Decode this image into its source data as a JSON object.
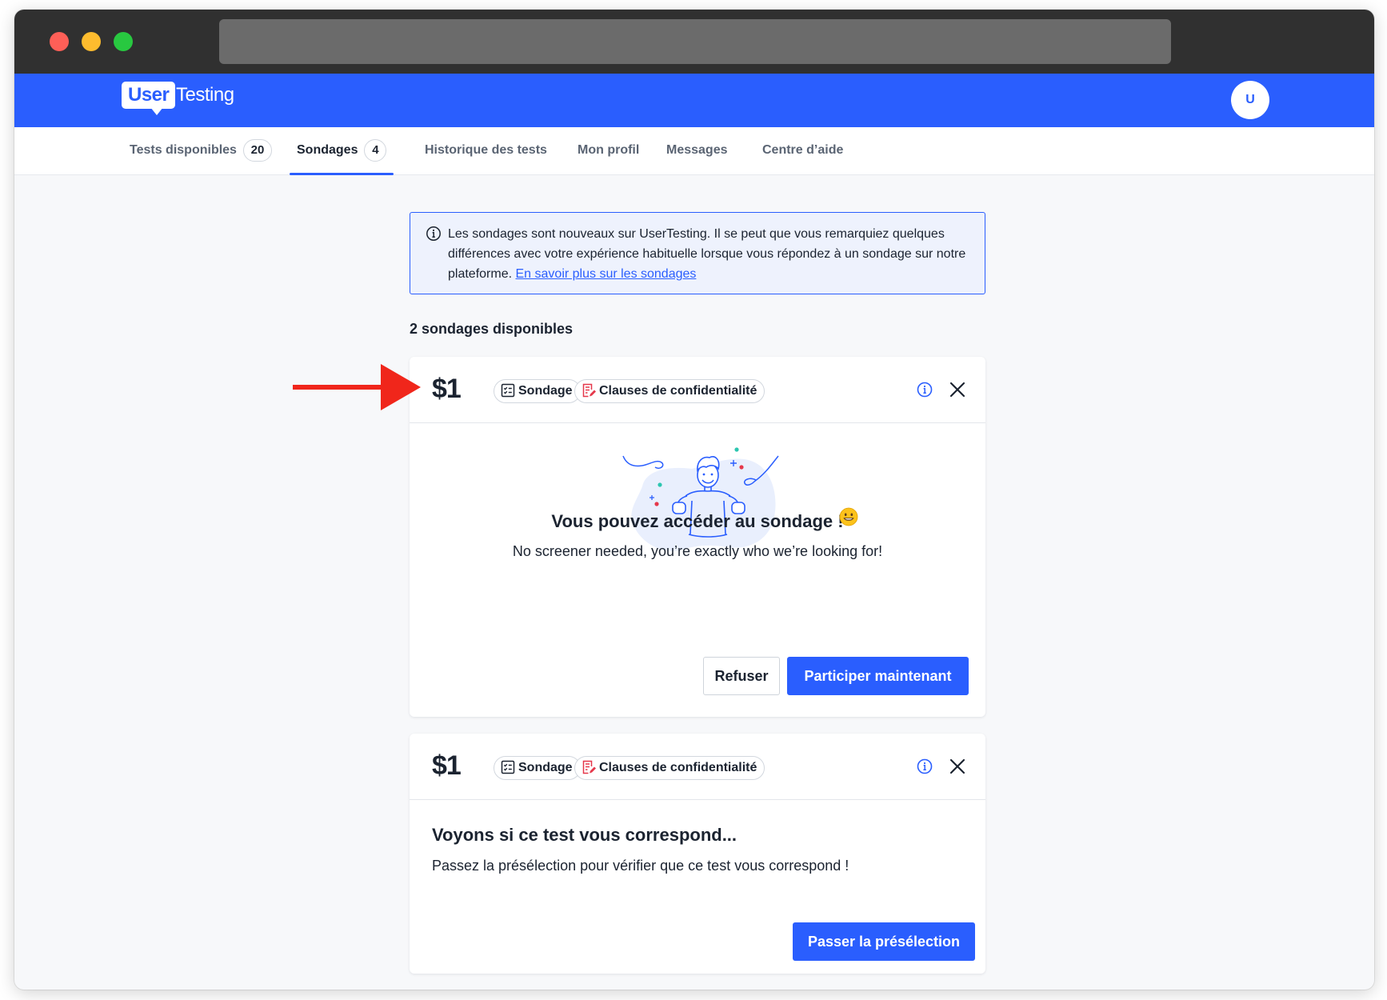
{
  "header": {
    "logo_user": "User",
    "logo_testing": "Testing",
    "avatar_initial": "U"
  },
  "tabs": [
    {
      "label": "Tests disponibles",
      "count": "20"
    },
    {
      "label": "Sondages",
      "count": "4",
      "active": true
    },
    {
      "label": "Historique des tests"
    },
    {
      "label": "Mon profil"
    },
    {
      "label": "Messages"
    },
    {
      "label": "Centre d’aide"
    }
  ],
  "notice": {
    "text": "Les sondages sont nouveaux sur UserTesting. Il se peut que vous remarquiez quelques différences avec votre expérience habituelle lorsque vous répondez à un sondage sur notre plateforme.",
    "link": "En savoir plus sur les sondages"
  },
  "available_label": "2 sondages disponibles",
  "cards": [
    {
      "price": "$1",
      "chip_survey": "Sondage",
      "chip_privacy": "Clauses de confidentialité",
      "title": "Vous pouvez accéder au sondage !",
      "subtitle": "No screener needed, you’re exactly who we’re looking for!",
      "decline_label": "Refuser",
      "primary_label": "Participer maintenant"
    },
    {
      "price": "$1",
      "chip_survey": "Sondage",
      "chip_privacy": "Clauses de confidentialité",
      "title": "Voyons si ce test vous correspond...",
      "subtitle": "Passez la présélection pour vérifier que ce test vous correspond !",
      "primary_label": "Passer la présélection"
    }
  ],
  "colors": {
    "brand_blue": "#2a5efe",
    "annotation_arrow": "#f0261b",
    "privacy_red": "#e5384b"
  },
  "icons": [
    "info-icon",
    "close-icon",
    "survey-checklist-icon",
    "privacy-doc-icon",
    "smiling-emoji-icon",
    "celebrating-person-illustration",
    "annotation-arrow"
  ]
}
